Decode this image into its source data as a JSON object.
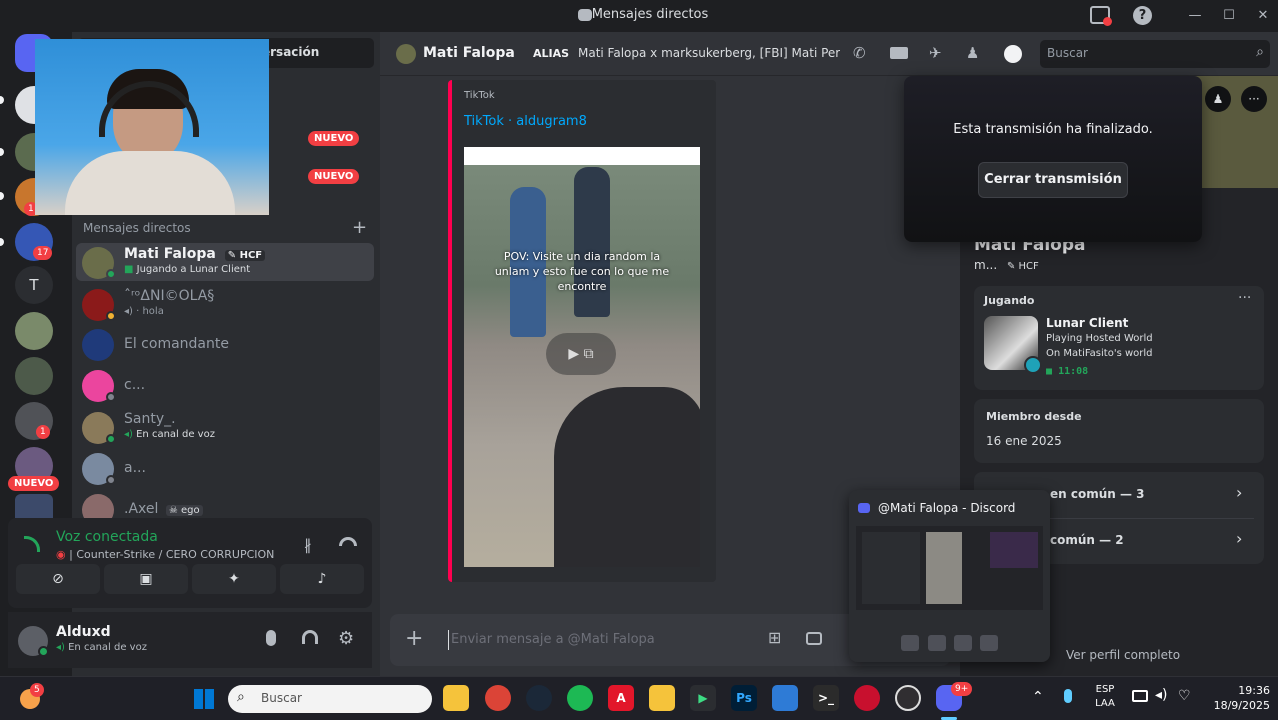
{
  "window": {
    "title": "Mensajes directos",
    "discord_glyph": "discord-icon"
  },
  "servers": {
    "badges": [
      "1",
      "17",
      "1"
    ],
    "t_letter": "T",
    "nuevo": "NUEVO"
  },
  "dm_sidebar": {
    "conversation_button_partial": "ersación",
    "nuevo_label": "NUEVO",
    "section_title": "Mensajes directos",
    "add_glyph": "+",
    "items": [
      {
        "name": "Mati Falopa",
        "tag": "HCF",
        "sub": "Jugando a Lunar Client"
      },
      {
        "name": "ˆʳᵒΔNI©OLA§",
        "sub": "hola"
      },
      {
        "name": "El comandante"
      },
      {
        "name": "c..."
      },
      {
        "name": "Santy_.",
        "sub": "En canal de voz"
      },
      {
        "name": "a..."
      },
      {
        "name": ".Axel",
        "tag": "ego"
      }
    ]
  },
  "voice_panel": {
    "status": "Voz conectada",
    "channel": "Counter-Strike / CERO CORRUPCION"
  },
  "user_panel": {
    "name": "Alduxd",
    "status": "En canal de voz"
  },
  "chat_header": {
    "name": "Mati Falopa",
    "alias_label": "ALIAS",
    "alias_value": "Mati Falopa x marksukerberg, [FBI] Mati Per...",
    "search_placeholder": "Buscar"
  },
  "embed": {
    "provider": "TikTok",
    "title": "TikTok · aldugram8",
    "caption": "POV: Visite un dia random la unlam y esto fue con lo que me encontre"
  },
  "composer": {
    "placeholder": "Enviar mensaje a @Mati Falopa"
  },
  "stream_overlay": {
    "message": "Esta transmisión ha finalizado.",
    "button": "Cerrar transmisión"
  },
  "profile": {
    "name": "Mati Falopa",
    "handle": "m...",
    "tag": "HCF",
    "activity_label": "Jugando",
    "game": "Lunar Client",
    "line1": "Playing Hosted World",
    "line2": "On MatiFasito's world",
    "time": "11:08",
    "member_since_label": "Miembro desde",
    "member_since": "16 ene 2025",
    "common1": "en común — 3",
    "common2": "común — 2",
    "view_full": "Ver perfil completo"
  },
  "preview": {
    "title": "@Mati Falopa - Discord"
  },
  "taskbar": {
    "search_placeholder": "Buscar",
    "lang": "ESP",
    "region": "LAA",
    "time": "19:36",
    "date": "18/9/2025",
    "notif_badge": "5",
    "discord_badge": "9+"
  },
  "colors": {
    "accent": "#5865f2",
    "green": "#23a55a",
    "red": "#f23f43",
    "link": "#00a8fc"
  }
}
